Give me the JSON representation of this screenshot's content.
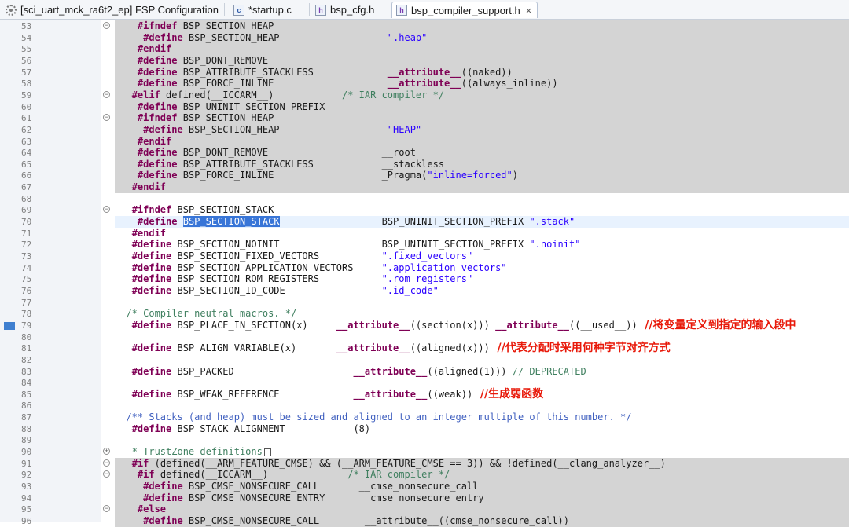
{
  "tabs": [
    {
      "label": "[sci_uart_mck_ra6t2_ep] FSP Configuration",
      "icon": "gear-icon"
    },
    {
      "label": "*startup.c",
      "icon": "c-file-icon"
    },
    {
      "label": "bsp_cfg.h",
      "icon": "h-file-icon"
    },
    {
      "label": "bsp_compiler_support.h",
      "icon": "h-file-icon",
      "close": "×"
    }
  ],
  "lines": [
    {
      "n": "53",
      "fold": "−",
      "hl": "gray",
      "p": [
        [
          "t",
          "    "
        ],
        [
          "k",
          "#ifndef"
        ],
        [
          "t",
          " BSP_SECTION_HEAP"
        ]
      ]
    },
    {
      "n": "54",
      "hl": "gray",
      "p": [
        [
          "t",
          "     "
        ],
        [
          "k",
          "#define"
        ],
        [
          "t",
          " BSP_SECTION_HEAP                   "
        ],
        [
          "s",
          "\".heap\""
        ]
      ]
    },
    {
      "n": "55",
      "hl": "gray",
      "p": [
        [
          "t",
          "    "
        ],
        [
          "k",
          "#endif"
        ]
      ]
    },
    {
      "n": "56",
      "hl": "gray",
      "p": [
        [
          "t",
          "    "
        ],
        [
          "k",
          "#define"
        ],
        [
          "t",
          " BSP_DONT_REMOVE"
        ]
      ]
    },
    {
      "n": "57",
      "hl": "gray",
      "p": [
        [
          "t",
          "    "
        ],
        [
          "k",
          "#define"
        ],
        [
          "t",
          " BSP_ATTRIBUTE_STACKLESS             "
        ],
        [
          "k",
          "__attribute__"
        ],
        [
          "t",
          "((naked))"
        ]
      ]
    },
    {
      "n": "58",
      "hl": "gray",
      "p": [
        [
          "t",
          "    "
        ],
        [
          "k",
          "#define"
        ],
        [
          "t",
          " BSP_FORCE_INLINE                    "
        ],
        [
          "k",
          "__attribute__"
        ],
        [
          "t",
          "((always_inline))"
        ]
      ]
    },
    {
      "n": "59",
      "fold": "−",
      "hl": "gray",
      "p": [
        [
          "t",
          "   "
        ],
        [
          "k",
          "#elif"
        ],
        [
          "t",
          " defined(__ICCARM__)            "
        ],
        [
          "c",
          "/* IAR compiler */"
        ]
      ]
    },
    {
      "n": "60",
      "hl": "gray",
      "p": [
        [
          "t",
          "    "
        ],
        [
          "k",
          "#define"
        ],
        [
          "t",
          " BSP_UNINIT_SECTION_PREFIX"
        ]
      ]
    },
    {
      "n": "61",
      "fold": "−",
      "hl": "gray",
      "p": [
        [
          "t",
          "    "
        ],
        [
          "k",
          "#ifndef"
        ],
        [
          "t",
          " BSP_SECTION_HEAP"
        ]
      ]
    },
    {
      "n": "62",
      "hl": "gray",
      "p": [
        [
          "t",
          "     "
        ],
        [
          "k",
          "#define"
        ],
        [
          "t",
          " BSP_SECTION_HEAP                   "
        ],
        [
          "s",
          "\"HEAP\""
        ]
      ]
    },
    {
      "n": "63",
      "hl": "gray",
      "p": [
        [
          "t",
          "    "
        ],
        [
          "k",
          "#endif"
        ]
      ]
    },
    {
      "n": "64",
      "hl": "gray",
      "p": [
        [
          "t",
          "    "
        ],
        [
          "k",
          "#define"
        ],
        [
          "t",
          " BSP_DONT_REMOVE                    __root"
        ]
      ]
    },
    {
      "n": "65",
      "hl": "gray",
      "p": [
        [
          "t",
          "    "
        ],
        [
          "k",
          "#define"
        ],
        [
          "t",
          " BSP_ATTRIBUTE_STACKLESS            __stackless"
        ]
      ]
    },
    {
      "n": "66",
      "hl": "gray",
      "p": [
        [
          "t",
          "    "
        ],
        [
          "k",
          "#define"
        ],
        [
          "t",
          " BSP_FORCE_INLINE                   _Pragma("
        ],
        [
          "s",
          "\"inline=forced\""
        ],
        [
          "t",
          ")"
        ]
      ]
    },
    {
      "n": "67",
      "hl": "gray",
      "p": [
        [
          "t",
          "   "
        ],
        [
          "k",
          "#endif"
        ]
      ]
    },
    {
      "n": "68",
      "p": []
    },
    {
      "n": "69",
      "fold": "−",
      "p": [
        [
          "t",
          "   "
        ],
        [
          "k",
          "#ifndef"
        ],
        [
          "t",
          " BSP_SECTION_STACK"
        ]
      ]
    },
    {
      "n": "70",
      "hl": "cur",
      "p": [
        [
          "t",
          "    "
        ],
        [
          "k",
          "#define"
        ],
        [
          "t",
          " "
        ],
        [
          "sel",
          "BSP_SECTION_STACK"
        ],
        [
          "t",
          "                  BSP_UNINIT_SECTION_PREFIX "
        ],
        [
          "s",
          "\".stack\""
        ]
      ]
    },
    {
      "n": "71",
      "p": [
        [
          "t",
          "   "
        ],
        [
          "k",
          "#endif"
        ]
      ]
    },
    {
      "n": "72",
      "p": [
        [
          "t",
          "   "
        ],
        [
          "k",
          "#define"
        ],
        [
          "t",
          " BSP_SECTION_NOINIT                  BSP_UNINIT_SECTION_PREFIX "
        ],
        [
          "s",
          "\".noinit\""
        ]
      ]
    },
    {
      "n": "73",
      "p": [
        [
          "t",
          "   "
        ],
        [
          "k",
          "#define"
        ],
        [
          "t",
          " BSP_SECTION_FIXED_VECTORS           "
        ],
        [
          "s",
          "\".fixed_vectors\""
        ]
      ]
    },
    {
      "n": "74",
      "p": [
        [
          "t",
          "   "
        ],
        [
          "k",
          "#define"
        ],
        [
          "t",
          " BSP_SECTION_APPLICATION_VECTORS     "
        ],
        [
          "s",
          "\".application_vectors\""
        ]
      ]
    },
    {
      "n": "75",
      "p": [
        [
          "t",
          "   "
        ],
        [
          "k",
          "#define"
        ],
        [
          "t",
          " BSP_SECTION_ROM_REGISTERS           "
        ],
        [
          "s",
          "\".rom_registers\""
        ]
      ]
    },
    {
      "n": "76",
      "p": [
        [
          "t",
          "   "
        ],
        [
          "k",
          "#define"
        ],
        [
          "t",
          " BSP_SECTION_ID_CODE                 "
        ],
        [
          "s",
          "\".id_code\""
        ]
      ]
    },
    {
      "n": "77",
      "p": []
    },
    {
      "n": "78",
      "p": [
        [
          "t",
          "  "
        ],
        [
          "c",
          "/* Compiler neutral macros. */"
        ]
      ]
    },
    {
      "n": "79",
      "mark": true,
      "p": [
        [
          "t",
          "   "
        ],
        [
          "k",
          "#define"
        ],
        [
          "t",
          " BSP_PLACE_IN_SECTION(x)     "
        ],
        [
          "k",
          "__attribute__"
        ],
        [
          "t",
          "((section(x))) "
        ],
        [
          "k",
          "__attribute__"
        ],
        [
          "t",
          "((__used__))"
        ]
      ]
    },
    {
      "n": "80",
      "p": []
    },
    {
      "n": "81",
      "p": [
        [
          "t",
          "   "
        ],
        [
          "k",
          "#define"
        ],
        [
          "t",
          " BSP_ALIGN_VARIABLE(x)       "
        ],
        [
          "k",
          "__attribute__"
        ],
        [
          "t",
          "((aligned(x)))"
        ]
      ]
    },
    {
      "n": "82",
      "p": []
    },
    {
      "n": "83",
      "p": [
        [
          "t",
          "   "
        ],
        [
          "k",
          "#define"
        ],
        [
          "t",
          " BSP_PACKED                     "
        ],
        [
          "k",
          "__attribute__"
        ],
        [
          "t",
          "((aligned(1))) "
        ],
        [
          "c",
          "// DEPRECATED"
        ]
      ]
    },
    {
      "n": "84",
      "p": []
    },
    {
      "n": "85",
      "p": [
        [
          "t",
          "   "
        ],
        [
          "k",
          "#define"
        ],
        [
          "t",
          " BSP_WEAK_REFERENCE             "
        ],
        [
          "k",
          "__attribute__"
        ],
        [
          "t",
          "((weak))"
        ]
      ]
    },
    {
      "n": "86",
      "p": []
    },
    {
      "n": "87",
      "p": [
        [
          "t",
          "  "
        ],
        [
          "cb",
          "/** Stacks (and heap) must be sized and aligned to an integer multiple of this number. */"
        ]
      ]
    },
    {
      "n": "88",
      "p": [
        [
          "t",
          "   "
        ],
        [
          "k",
          "#define"
        ],
        [
          "t",
          " BSP_STACK_ALIGNMENT            (8)"
        ]
      ]
    },
    {
      "n": "89",
      "p": []
    },
    {
      "n": "90",
      "fold": "+",
      "p": [
        [
          "t",
          "   "
        ],
        [
          "c",
          "* TrustZone definitions"
        ]
      ],
      "box": true
    },
    {
      "n": "91",
      "fold": "−",
      "hl": "gray",
      "p": [
        [
          "t",
          "   "
        ],
        [
          "k",
          "#if"
        ],
        [
          "t",
          " (defined(__ARM_FEATURE_CMSE) && (__ARM_FEATURE_CMSE == 3)) && !defined(__clang_analyzer__)"
        ]
      ]
    },
    {
      "n": "92",
      "fold": "−",
      "hl": "gray",
      "p": [
        [
          "t",
          "    "
        ],
        [
          "k",
          "#if"
        ],
        [
          "t",
          " defined(__ICCARM__)              "
        ],
        [
          "c",
          "/* IAR compiler */"
        ]
      ]
    },
    {
      "n": "93",
      "hl": "gray",
      "p": [
        [
          "t",
          "     "
        ],
        [
          "k",
          "#define"
        ],
        [
          "t",
          " BSP_CMSE_NONSECURE_CALL       __cmse_nonsecure_call"
        ]
      ]
    },
    {
      "n": "94",
      "hl": "gray",
      "p": [
        [
          "t",
          "     "
        ],
        [
          "k",
          "#define"
        ],
        [
          "t",
          " BSP_CMSE_NONSECURE_ENTRY      __cmse_nonsecure_entry"
        ]
      ]
    },
    {
      "n": "95",
      "fold": "−",
      "hl": "gray",
      "p": [
        [
          "t",
          "    "
        ],
        [
          "k",
          "#else"
        ]
      ]
    },
    {
      "n": "96",
      "hl": "gray",
      "p": [
        [
          "t",
          "     "
        ],
        [
          "k",
          "#define"
        ],
        [
          "t",
          " BSP_CMSE_NONSECURE_CALL        __attribute__((cmse_nonsecure_call))"
        ]
      ]
    }
  ],
  "annotations": [
    {
      "line_index": 26,
      "text": "//将变量定义到指定的输入段中"
    },
    {
      "line_index": 28,
      "text": "//代表分配时采用何种字节对齐方式"
    },
    {
      "line_index": 32,
      "text": "//生成弱函数"
    }
  ]
}
